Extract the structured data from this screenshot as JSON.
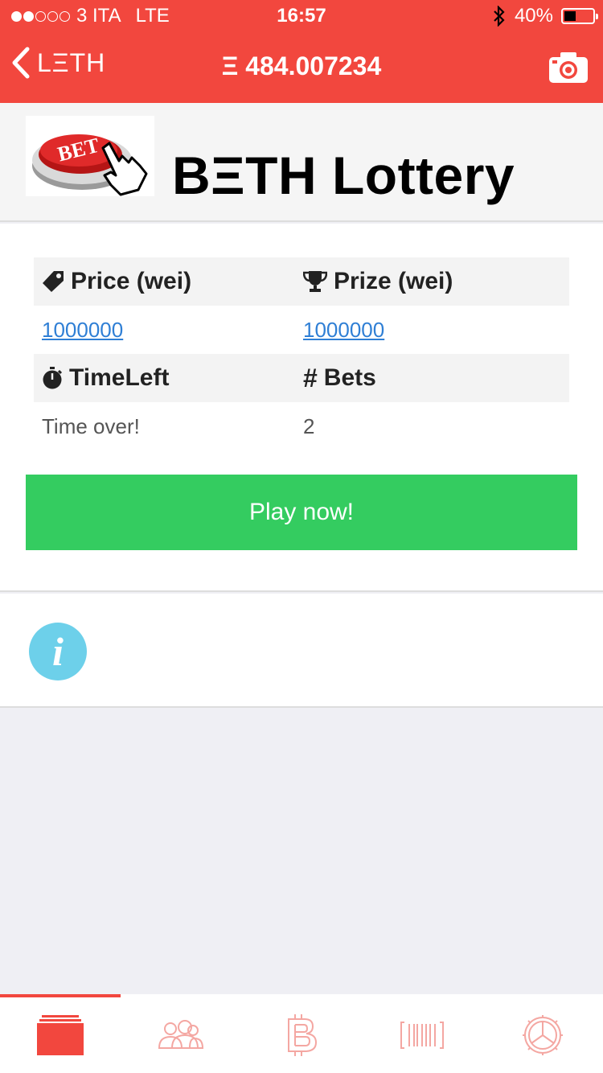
{
  "status_bar": {
    "carrier": "3 ITA",
    "network": "LTE",
    "time": "16:57",
    "battery": "40%",
    "battery_level": 0.4
  },
  "nav": {
    "back_label": "LΞTH",
    "balance": "Ξ 484.007234"
  },
  "header": {
    "title": "BΞTH Lottery",
    "logo_text": "BET"
  },
  "lottery": {
    "price_label": "Price (wei)",
    "prize_label": "Prize (wei)",
    "price_value": "1000000",
    "prize_value": "1000000",
    "timeleft_label": "TimeLeft",
    "bets_label": "Bets",
    "timeleft_value": "Time over!",
    "bets_value": "2",
    "play_button": "Play now!"
  },
  "info": {
    "icon": "i"
  },
  "tabs": [
    {
      "icon": "cards-icon",
      "active": true
    },
    {
      "icon": "people-icon",
      "active": false
    },
    {
      "icon": "bitcoin-icon",
      "active": false
    },
    {
      "icon": "barcode-icon",
      "active": false
    },
    {
      "icon": "settings-icon",
      "active": false
    }
  ],
  "colors": {
    "accent": "#f2473e",
    "play_green": "#34cc60",
    "link_blue": "#2f7fd5",
    "info_blue": "#6dd0ea"
  }
}
